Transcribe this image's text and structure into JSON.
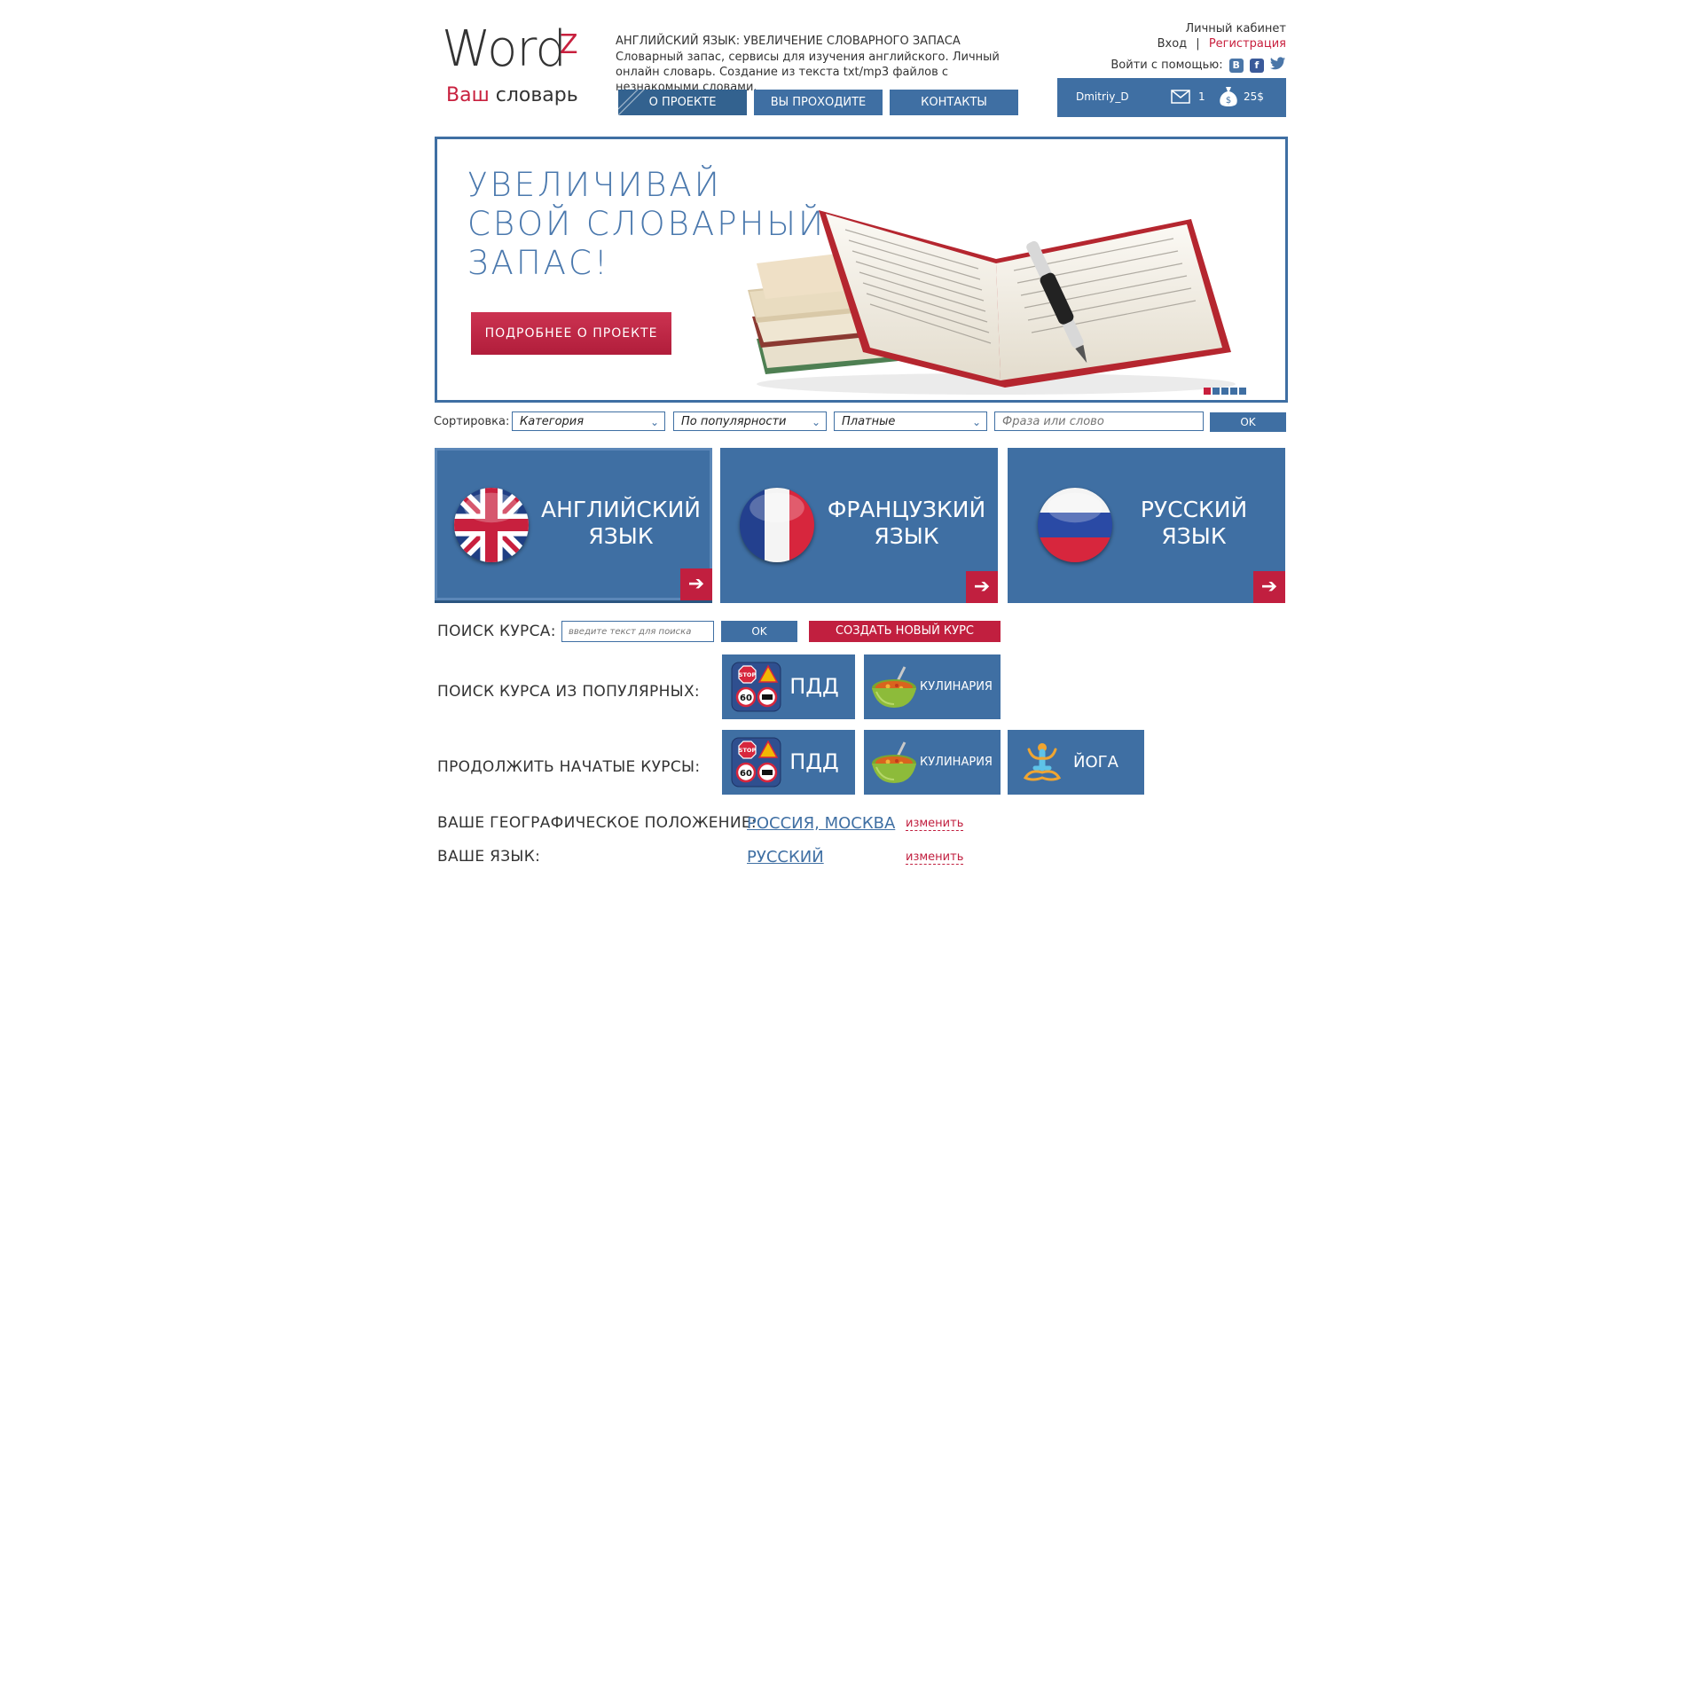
{
  "header": {
    "logo_word": "Word",
    "logo_sup": "Z",
    "logo_sub_hl": "Ваш",
    "logo_sub_rest": "словарь",
    "desc_title": "АНГЛИЙСКИЙ ЯЗЫК: УВЕЛИЧЕНИЕ СЛОВАРНОГО ЗАПАСА",
    "desc_text": "Словарный запас, сервисы для изучения английского. Личный онлайн словарь. Создание из текста txt/mp3 файлов с незнакомыми словами.",
    "nav": [
      "О ПРОЕКТЕ",
      "ВЫ ПРОХОДИТЕ",
      "КОНТАКТЫ"
    ]
  },
  "account": {
    "title": "Личный кабинет",
    "login": "Вход",
    "separator": "|",
    "register": "Регистрация",
    "login_with": "Войти с помощью:",
    "socials": [
      "vk",
      "facebook",
      "twitter"
    ],
    "username": "Dmitriy_D",
    "messages": "1",
    "balance": "25$"
  },
  "banner": {
    "title_lines": [
      "УВЕЛИЧИВАЙ",
      "СВОЙ СЛОВАРНЫЙ",
      "ЗАПАС!"
    ],
    "button": "ПОДРОБНЕЕ О ПРОЕКТЕ",
    "slides": 5,
    "active_slide": 1
  },
  "filters": {
    "label": "Сортировка:",
    "category": "Категория",
    "popularity": "По популярности",
    "paid": "Платные",
    "phrase_placeholder": "Фраза или слово",
    "ok": "OK"
  },
  "languages": [
    {
      "line1": "АНГЛИЙСКИЙ",
      "line2": "ЯЗЫК",
      "flag": "uk-flag-icon"
    },
    {
      "line1": "ФРАНЦУЗКИЙ",
      "line2": "ЯЗЫК",
      "flag": "france-flag-icon"
    },
    {
      "line1": "РУССКИЙ",
      "line2": "ЯЗЫК",
      "flag": "russia-flag-icon"
    }
  ],
  "course_search": {
    "label": "ПОИСК КУРСА:",
    "placeholder": "введите текст для поиска",
    "ok": "OK",
    "create": "СОЗДАТЬ НОВЫЙ КУРС"
  },
  "popular": {
    "label": "ПОИСК КУРСА ИЗ ПОПУЛЯРНЫХ:",
    "items": [
      "ПДД",
      "КУЛИНАРИЯ"
    ]
  },
  "continue": {
    "label": "ПРОДОЛЖИТЬ НАЧАТЫЕ КУРСЫ:",
    "items": [
      "ПДД",
      "КУЛИНАРИЯ",
      "ЙОГА"
    ]
  },
  "icon_texts": {
    "stop": "STOP",
    "speed": "60"
  },
  "location": {
    "label": "ВАШЕ ГЕОГРАФИЧЕСКОЕ ПОЛОЖЕНИЕ:",
    "value": "РОССИЯ, МОСКВА",
    "change": "изменить"
  },
  "language": {
    "label": "ВАШЕ ЯЗЫК:",
    "value": "РУССКИЙ",
    "change": "изменить"
  },
  "colors": {
    "accent_blue": "#3f6fa3",
    "accent_red": "#c11f3f"
  }
}
